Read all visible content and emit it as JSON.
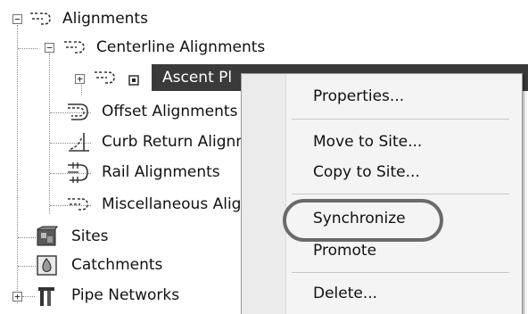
{
  "tree": {
    "items": [
      {
        "label": "Alignments",
        "icon": "alignment-icon",
        "toggle": "−"
      },
      {
        "label": "Centerline Alignments",
        "icon": "alignment-icon",
        "toggle": "−"
      },
      {
        "label": "Ascent Pl",
        "icon": "alignment-icon",
        "toggle": "+",
        "selected": true
      },
      {
        "label": "Offset Alignments",
        "icon": "offset-alignment-icon"
      },
      {
        "label": "Curb Return Alignm",
        "icon": "curb-return-icon"
      },
      {
        "label": "Rail Alignments",
        "icon": "rail-alignment-icon"
      },
      {
        "label": "Miscellaneous Align",
        "icon": "misc-alignment-icon"
      },
      {
        "label": "Sites",
        "icon": "sites-icon"
      },
      {
        "label": "Catchments",
        "icon": "catchments-icon"
      },
      {
        "label": "Pipe Networks",
        "icon": "pipe-networks-icon",
        "toggle": "+"
      }
    ]
  },
  "context_menu": {
    "items": [
      {
        "label": "Properties..."
      },
      {
        "label": "Move to Site..."
      },
      {
        "label": "Copy to Site..."
      },
      {
        "label": "Synchronize",
        "circled": true
      },
      {
        "label": "Promote"
      },
      {
        "label": "Delete..."
      }
    ]
  },
  "colors": {
    "selection": "#3a3a3a",
    "menu_background": "#f4f4f4",
    "ring": "#6a6a6a"
  }
}
